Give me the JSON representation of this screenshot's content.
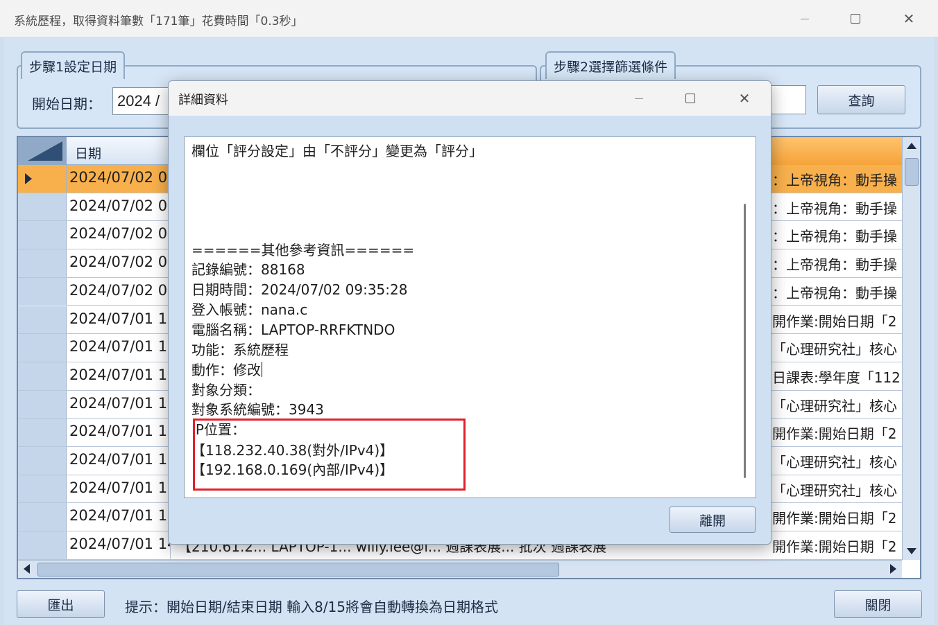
{
  "window": {
    "title": "系統歷程，取得資料筆數「171筆」花費時間「0.3秒」"
  },
  "step1": {
    "tab_label": "步驟1設定日期",
    "start_label": "開始日期：",
    "start_value": "2024 /"
  },
  "step2": {
    "tab_label": "步驟2選擇篩選條件",
    "query_button": "查詢"
  },
  "grid": {
    "header_date": "日期",
    "rows": [
      {
        "date": "2024/07/02 0",
        "right": "：上帝視角：動手操"
      },
      {
        "date": "2024/07/02 0",
        "right": "：上帝視角：動手操"
      },
      {
        "date": "2024/07/02 0",
        "right": "：上帝視角：動手操"
      },
      {
        "date": "2024/07/02 0",
        "right": "：上帝視角：動手操"
      },
      {
        "date": "2024/07/02 0",
        "right": "：上帝視角：動手操"
      },
      {
        "date": "2024/07/01 1",
        "right": "開作業:開始日期「2"
      },
      {
        "date": "2024/07/01 1",
        "right": "「心理研究社」核心"
      },
      {
        "date": "2024/07/01 1",
        "right": "日課表:學年度「112"
      },
      {
        "date": "2024/07/01 1",
        "right": "「心理研究社」核心"
      },
      {
        "date": "2024/07/01 1",
        "right": "開作業:開始日期「2"
      },
      {
        "date": "2024/07/01 1",
        "right": "「心理研究社」核心"
      },
      {
        "date": "2024/07/01 1",
        "right": "「心理研究社」核心"
      },
      {
        "date": "2024/07/01 1",
        "right": "開作業:開始日期「2"
      },
      {
        "date": "2024/07/01 14...",
        "right": "開作業:開始日期「2"
      }
    ],
    "last_row_mid": "【210.61.2...   LAPTOP-1...   willy.lee@i...   週課表展...   批次   週課表展"
  },
  "footer": {
    "export_button": "匯出",
    "hint": "提示：開始日期/結束日期 輸入8/15將會自動轉換為日期格式",
    "close_button": "關閉"
  },
  "dialog": {
    "title": "詳細資料",
    "lines": [
      "欄位「評分設定」由「不評分」變更為「評分」",
      "======其他參考資訊======",
      "記錄編號：88168",
      "日期時間：2024/07/02 09:35:28",
      "登入帳號：nana.c",
      "電腦名稱：LAPTOP-RRFKTNDO",
      "功能：系統歷程",
      "動作：修改",
      "對象分類：",
      "對象系統編號：3943",
      "IP位置：",
      "【118.232.40.38(對外/IPv4)】",
      "【192.168.0.169(內部/IPv4)】"
    ],
    "leave_button": "離開"
  }
}
